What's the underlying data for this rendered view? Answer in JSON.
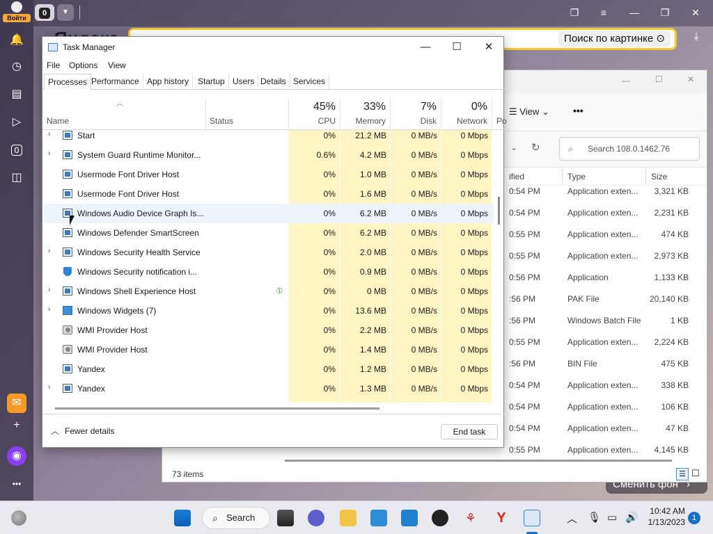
{
  "browser": {
    "login_label": "Войти",
    "tab_count": "0",
    "logo_text": "Яндекс",
    "image_search_label": "Поиск по картинке",
    "background_button": "Сменить фон",
    "left_counter": "0"
  },
  "explorer": {
    "view_label": "View",
    "more_label": "•••",
    "search_placeholder": "Search 108.0.1462.76",
    "columns": {
      "modified": "ified",
      "type": "Type",
      "size": "Size"
    },
    "rows": [
      {
        "modified": "0:54 PM",
        "type": "Application exten...",
        "size": "3,321 KB"
      },
      {
        "modified": "0:54 PM",
        "type": "Application exten...",
        "size": "2,231 KB"
      },
      {
        "modified": "0:55 PM",
        "type": "Application exten...",
        "size": "474 KB"
      },
      {
        "modified": "0:55 PM",
        "type": "Application exten...",
        "size": "2,973 KB"
      },
      {
        "modified": "0:56 PM",
        "type": "Application",
        "size": "1,133 KB"
      },
      {
        "modified": ":56 PM",
        "type": "PAK File",
        "size": "20,140 KB"
      },
      {
        "modified": ":56 PM",
        "type": "Windows Batch File",
        "size": "1 KB"
      },
      {
        "modified": "0:55 PM",
        "type": "Application exten...",
        "size": "2,224 KB"
      },
      {
        "modified": ":56 PM",
        "type": "BIN File",
        "size": "475 KB"
      },
      {
        "modified": "0:54 PM",
        "type": "Application exten...",
        "size": "338 KB"
      },
      {
        "modified": "0:54 PM",
        "type": "Application exten...",
        "size": "106 KB"
      },
      {
        "modified": "0:54 PM",
        "type": "Application exten...",
        "size": "47 KB"
      },
      {
        "modified": "0:55 PM",
        "type": "Application exten...",
        "size": "4,145 KB"
      }
    ],
    "status": "73 items"
  },
  "taskmanager": {
    "title": "Task Manager",
    "menu": [
      "File",
      "Options",
      "View"
    ],
    "tabs": [
      "Processes",
      "Performance",
      "App history",
      "Startup",
      "Users",
      "Details",
      "Services"
    ],
    "columns": {
      "name": "Name",
      "status": "Status",
      "cpu": {
        "pct": "45%",
        "label": "CPU"
      },
      "memory": {
        "pct": "33%",
        "label": "Memory"
      },
      "disk": {
        "pct": "7%",
        "label": "Disk"
      },
      "network": {
        "pct": "0%",
        "label": "Network"
      },
      "power": "Po"
    },
    "processes": [
      {
        "name": "Start",
        "expand": true,
        "icon": "app-window-icon",
        "status": "",
        "cpu": "0%",
        "memory": "21.2 MB",
        "disk": "0 MB/s",
        "network": "0 Mbps"
      },
      {
        "name": "System Guard Runtime Monitor...",
        "expand": true,
        "icon": "app-window-icon",
        "status": "",
        "cpu": "0.6%",
        "memory": "4.2 MB",
        "disk": "0 MB/s",
        "network": "0 Mbps"
      },
      {
        "name": "Usermode Font Driver Host",
        "expand": false,
        "icon": "app-window-icon",
        "status": "",
        "cpu": "0%",
        "memory": "1.0 MB",
        "disk": "0 MB/s",
        "network": "0 Mbps"
      },
      {
        "name": "Usermode Font Driver Host",
        "expand": false,
        "icon": "app-window-icon",
        "status": "",
        "cpu": "0%",
        "memory": "1.6 MB",
        "disk": "0 MB/s",
        "network": "0 Mbps"
      },
      {
        "name": "Windows Audio Device Graph Is...",
        "expand": false,
        "icon": "app-window-icon",
        "status": "",
        "cpu": "0%",
        "memory": "6.2 MB",
        "disk": "0 MB/s",
        "network": "0 Mbps",
        "highlighted": true
      },
      {
        "name": "Windows Defender SmartScreen",
        "expand": false,
        "icon": "app-window-icon",
        "status": "",
        "cpu": "0%",
        "memory": "6.2 MB",
        "disk": "0 MB/s",
        "network": "0 Mbps"
      },
      {
        "name": "Windows Security Health Service",
        "expand": true,
        "icon": "app-window-icon",
        "status": "",
        "cpu": "0%",
        "memory": "2.0 MB",
        "disk": "0 MB/s",
        "network": "0 Mbps"
      },
      {
        "name": "Windows Security notification i...",
        "expand": false,
        "icon": "shield-icon",
        "status": "",
        "cpu": "0%",
        "memory": "0.9 MB",
        "disk": "0 MB/s",
        "network": "0 Mbps"
      },
      {
        "name": "Windows Shell Experience Host",
        "expand": true,
        "icon": "app-window-icon",
        "status": "suspended-leaf-icon",
        "cpu": "0%",
        "memory": "0 MB",
        "disk": "0 MB/s",
        "network": "0 Mbps"
      },
      {
        "name": "Windows Widgets (7)",
        "expand": true,
        "icon": "widgets-icon",
        "status": "",
        "cpu": "0%",
        "memory": "13.6 MB",
        "disk": "0 MB/s",
        "network": "0 Mbps"
      },
      {
        "name": "WMI Provider Host",
        "expand": false,
        "icon": "gear-icon",
        "status": "",
        "cpu": "0%",
        "memory": "2.2 MB",
        "disk": "0 MB/s",
        "network": "0 Mbps"
      },
      {
        "name": "WMI Provider Host",
        "expand": false,
        "icon": "gear-icon",
        "status": "",
        "cpu": "0%",
        "memory": "1.4 MB",
        "disk": "0 MB/s",
        "network": "0 Mbps"
      },
      {
        "name": "Yandex",
        "expand": false,
        "icon": "app-window-icon",
        "status": "",
        "cpu": "0%",
        "memory": "1.2 MB",
        "disk": "0 MB/s",
        "network": "0 Mbps"
      },
      {
        "name": "Yandex",
        "expand": true,
        "icon": "app-window-icon",
        "status": "",
        "cpu": "0%",
        "memory": "1.3 MB",
        "disk": "0 MB/s",
        "network": "0 Mbps"
      }
    ],
    "fewer_details": "Fewer details",
    "end_task": "End task"
  },
  "taskbar": {
    "search_label": "Search",
    "time": "10:42 AM",
    "date": "1/13/2023",
    "notification_count": "1"
  }
}
